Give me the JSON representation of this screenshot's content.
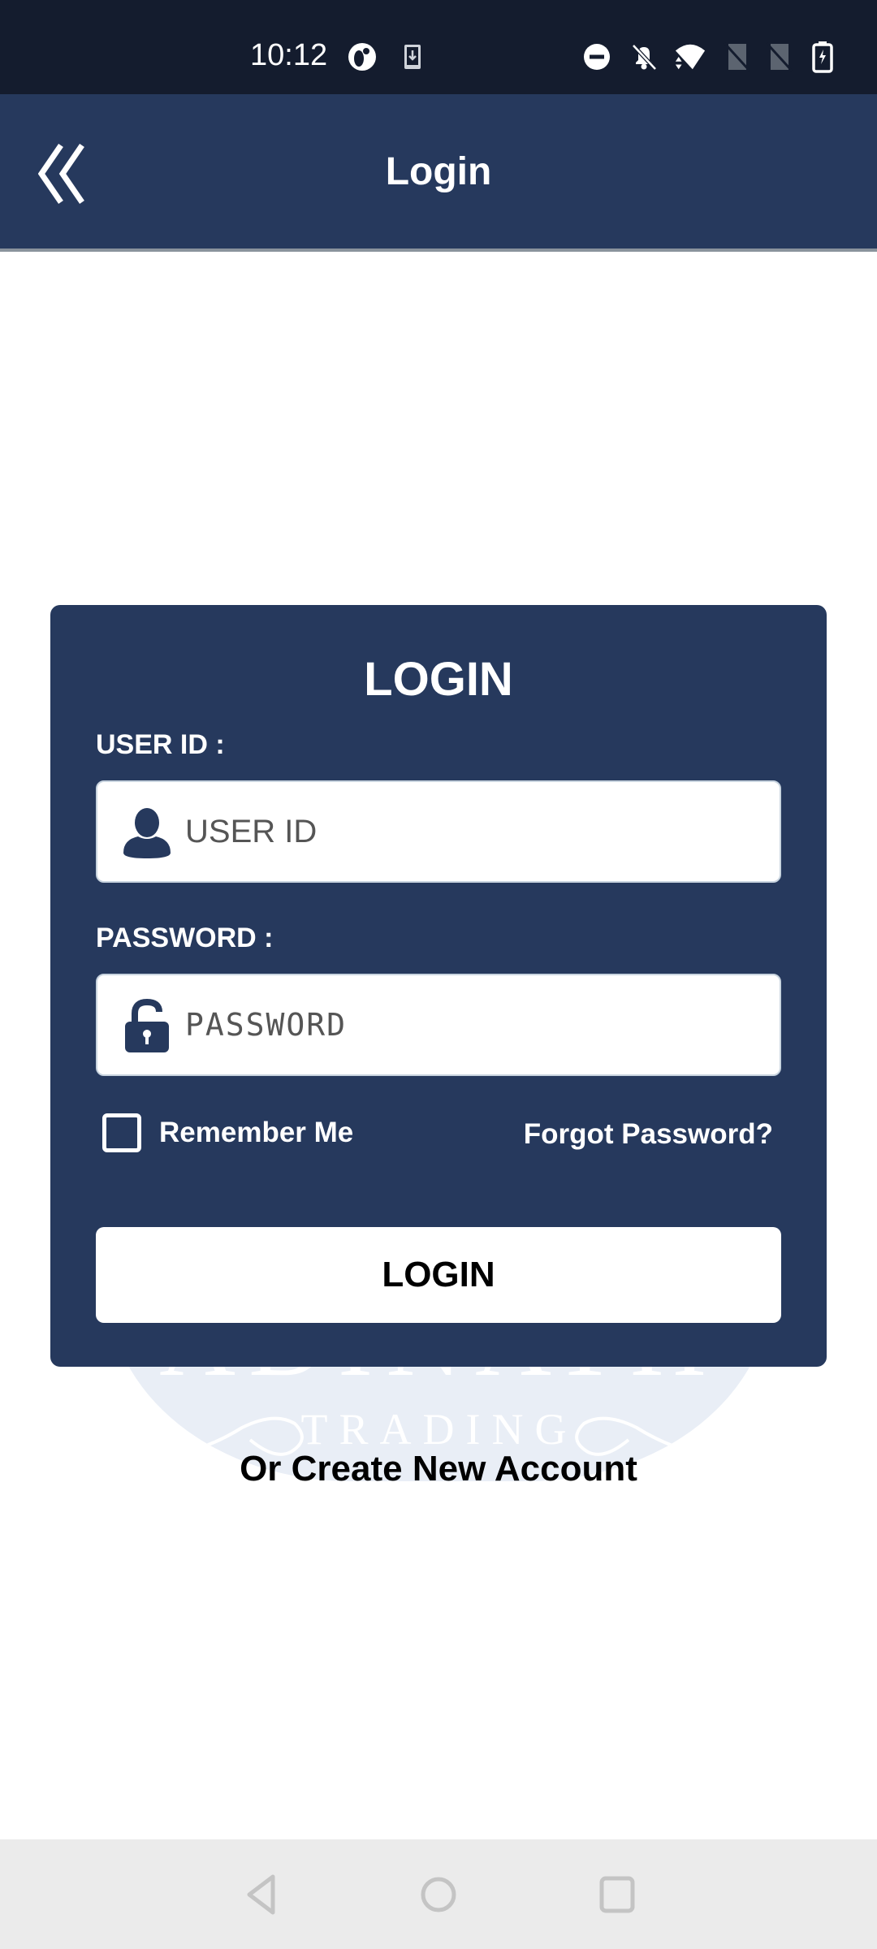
{
  "status_bar": {
    "time": "10:12",
    "icons": [
      "data-saver-icon",
      "download-icon",
      "do-not-disturb-icon",
      "notifications-off-icon",
      "wifi-icon",
      "no-sim-icon",
      "no-sim-icon",
      "battery-charging-icon"
    ]
  },
  "app_bar": {
    "title": "Login",
    "back_icon": "double-chevron-left-icon"
  },
  "login_card": {
    "title": "LOGIN",
    "user_id": {
      "label": "USER ID :",
      "placeholder": "USER ID",
      "value": "",
      "icon": "user-icon"
    },
    "password": {
      "label": "PASSWORD :",
      "placeholder": "PASSWORD",
      "value": "",
      "icon": "unlock-icon"
    },
    "remember_me": {
      "label": "Remember Me",
      "checked": false
    },
    "forgot_password": "Forgot Password?",
    "login_button": "LOGIN"
  },
  "watermark": {
    "name": "ADINATH",
    "subtitle": "TRADING"
  },
  "create_account_link": "Or Create New Account",
  "colors": {
    "primary": "#26395d",
    "status_bar": "#141c2e",
    "background": "#ffffff",
    "watermark": "#e9eef6",
    "nav_bar": "#ebebeb"
  },
  "nav_bar": {
    "buttons": [
      "back",
      "home",
      "recents"
    ]
  }
}
